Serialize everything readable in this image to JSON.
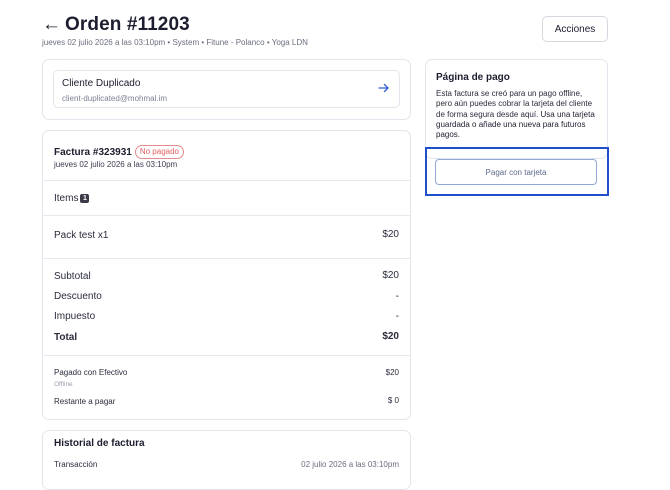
{
  "header": {
    "back_arrow": "←",
    "title": "Orden #11203",
    "subtitle": "jueves 02 julio 2026 a las 03:10pm • System • Fitune - Polanco • Yoga LDN",
    "actions_label": "Acciones"
  },
  "client": {
    "name": "Cliente Duplicado",
    "email": "client-duplicated@mohmal.im",
    "icon": "arrow-right-icon"
  },
  "invoice": {
    "title": "Factura #323931",
    "status": "No pagado",
    "date": "jueves 02 julio 2026 a las 03:10pm",
    "items_label": "Items",
    "items_count": "1",
    "items": [
      {
        "name": "Pack test x1",
        "price": "$20"
      }
    ],
    "subtotal_label": "Subtotal",
    "subtotal": "$20",
    "discount_label": "Descuento",
    "discount": "-",
    "tax_label": "Impuesto",
    "tax": "-",
    "total_label": "Total",
    "total": "$20",
    "paid_label": "Pagado con Efectivo",
    "paid_sub": "Offline",
    "paid": "$20",
    "remaining_label": "Restante a pagar",
    "remaining": "$ 0"
  },
  "history": {
    "title": "Historial de factura",
    "row_label": "Transacción",
    "row_date": "02 julio 2026 a las 03:10pm"
  },
  "payment_page": {
    "title": "Página de pago",
    "description_plain": "Esta factura se creó para un pago offline, pero aún puedes cobrar la tarjeta del cliente de forma segura desde aquí. ",
    "description_emph": "Usa una tarjeta guardada o añade una nueva para futuros pagos.",
    "button_label": "Pagar con tarjeta"
  },
  "colors": {
    "accent": "#1f4fcc",
    "status_unpaid": "#e05f5f",
    "border": "#e3e5ec"
  }
}
